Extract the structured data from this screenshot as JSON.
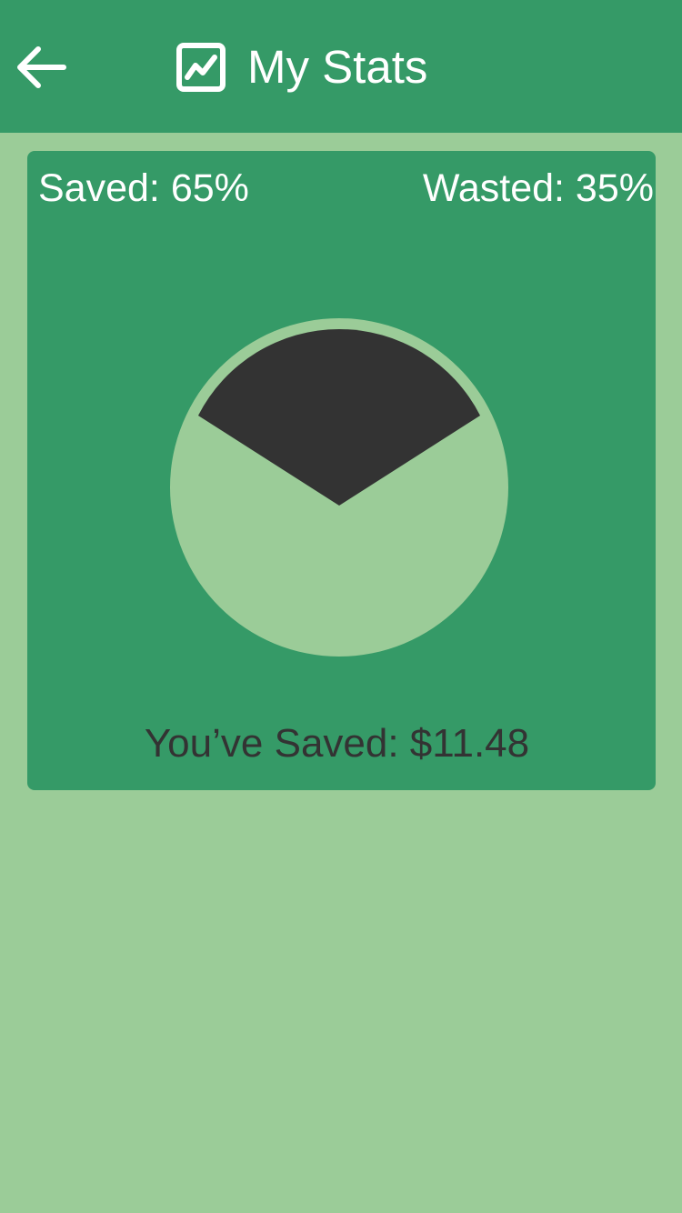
{
  "header": {
    "title": "My Stats",
    "back_icon": "arrow-left-icon",
    "title_icon": "line-chart-icon"
  },
  "stats": {
    "saved_label": "Saved: 65%",
    "wasted_label": "Wasted: 35%",
    "total_saved_label": "You’ve Saved: $11.48"
  },
  "chart_data": {
    "type": "pie",
    "title": "",
    "slices": [
      {
        "label": "Saved",
        "value": 65,
        "color": "#9bcc98"
      },
      {
        "label": "Wasted",
        "value": 35,
        "color": "#333333"
      }
    ]
  },
  "colors": {
    "primary": "#359a67",
    "background": "#9bcc98",
    "wasted": "#333333",
    "text_light": "#ffffff",
    "text_dark": "#333333"
  }
}
